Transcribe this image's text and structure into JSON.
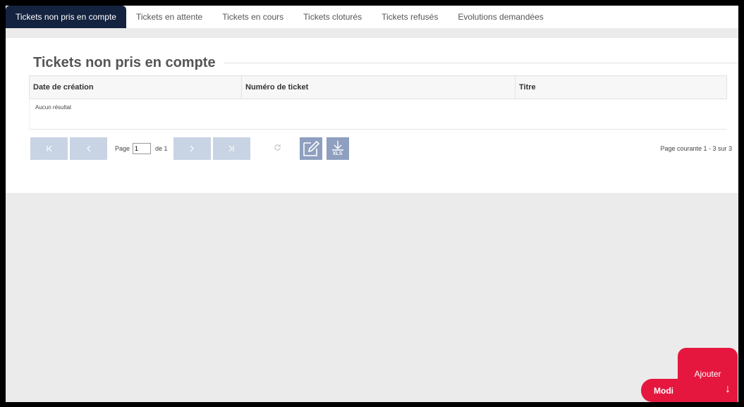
{
  "tabs": [
    {
      "label": "Tickets non pris en compte",
      "active": true
    },
    {
      "label": "Tickets en attente"
    },
    {
      "label": "Tickets en cours"
    },
    {
      "label": "Tickets cloturés"
    },
    {
      "label": "Tickets refusés"
    },
    {
      "label": "Evolutions demandées"
    }
  ],
  "page_title": "Tickets non pris en compte",
  "table": {
    "columns": [
      "Date de création",
      "Numéro de ticket",
      "Titre"
    ],
    "empty_text": "Aucun résultat"
  },
  "pager": {
    "page_label": "Page",
    "page_value": "1",
    "of_label": "de 1",
    "first_icon": "first-page-icon",
    "prev_icon": "prev-page-icon",
    "next_icon": "next-page-icon",
    "last_icon": "last-page-icon",
    "refresh_icon": "refresh-icon",
    "edit_icon": "edit-icon",
    "xls_icon": "xls-download-icon",
    "xls_text": "XLS",
    "info": "Page courante 1 - 3 sur 3"
  },
  "fab": {
    "add_label": "Ajouter",
    "modify_label": "Modi",
    "arrow_icon": "arrow-down-icon"
  },
  "colors": {
    "active_tab": "#14233f",
    "pager_button": "#c8d3e4",
    "icon_button": "#8e9fc0",
    "fab": "#e5173f"
  }
}
